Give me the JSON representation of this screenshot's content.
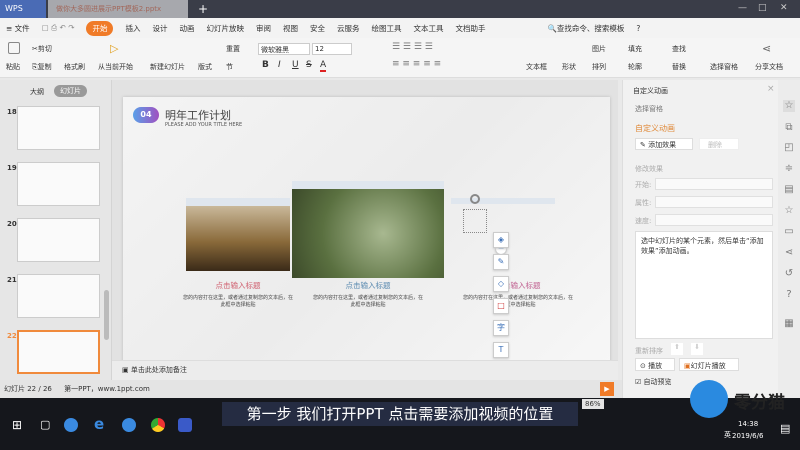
{
  "titlebar": {
    "app": "WPS",
    "doc_tab": "做你大多圆进展示PPT模板2.pptx",
    "new_tab": "+",
    "min": "—",
    "max": "□",
    "close": "✕"
  },
  "menu": {
    "file": "≡ 文件",
    "items": [
      "开始",
      "插入",
      "设计",
      "动画",
      "幻灯片放映",
      "审阅",
      "视图",
      "安全",
      "云服务",
      "绘图工具",
      "文本工具",
      "文档助手"
    ],
    "search": "查找命令、搜索模板",
    "help": "?"
  },
  "ribbon": {
    "paste": "粘贴",
    "cut": "剪切",
    "copy": "复制",
    "format_painter": "格式刷",
    "play_from_current": "从当前开始",
    "new_slide": "新建幻灯片",
    "layout": "版式",
    "reset": "重置",
    "section": "节",
    "font": "微软雅黑",
    "size": "12",
    "bold": "B",
    "italic": "I",
    "underline": "U",
    "strike": "S",
    "color": "A",
    "textbox": "文本框",
    "shape": "形状",
    "picture": "图片",
    "arrange": "排列",
    "fill": "填充",
    "outline": "轮廓",
    "find": "查找",
    "replace": "替换",
    "selection_pane": "选择窗格",
    "share": "分享文档"
  },
  "leftpanel": {
    "tab_outline": "大纲",
    "tab_slides": "幻灯片",
    "slides": [
      "18",
      "19",
      "20",
      "21",
      "22"
    ],
    "add": "+"
  },
  "slide": {
    "title": "明年工作计划",
    "subtitle": "PLEASE ADD YOUR TITLE HERE",
    "badge": "04",
    "captions": [
      "点击输入标题",
      "点击输入标题",
      "点击输入标题"
    ],
    "desc": "您的内容打在这里，或者通过复制您的文本后，在此框中选择粘贴"
  },
  "notes": "单击此处添加备注",
  "rightpanel": {
    "header": "自定义动画",
    "select_pane": "选择窗格",
    "section": "自定义动画",
    "add_effect": "添加效果",
    "delete": "删除",
    "modify": "修改效果",
    "start": "开始:",
    "property": "属性:",
    "speed": "速度:",
    "hint": "选中幻灯片的某个元素，然后单击“添加效果”添加动画。",
    "reorder": "重新排序",
    "play": "播放",
    "slideshow": "幻灯片播放",
    "autopreview": "自动预览"
  },
  "status": {
    "slide": "幻灯片 22 / 26",
    "theme": "第一PPT，www.1ppt.com",
    "zoom": "86%"
  },
  "subtitle": "第一步 我们打开PPT 点击需要添加视频的位置",
  "logo": "零分猫",
  "taskbar": {
    "time": "14:38",
    "date": "2019/6/6",
    "ime": "英"
  }
}
